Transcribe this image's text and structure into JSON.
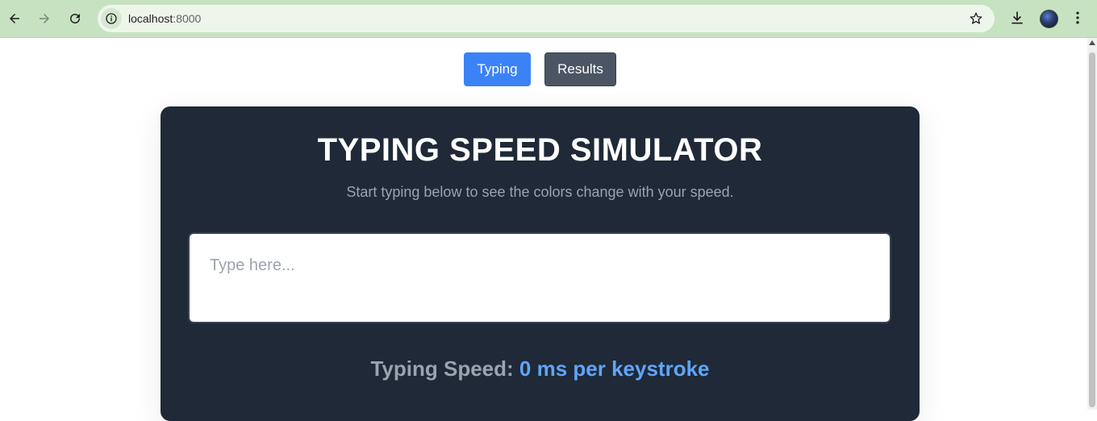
{
  "browser": {
    "url_host": "localhost",
    "url_port": ":8000"
  },
  "nav": {
    "tabs": [
      {
        "label": "Typing",
        "active": true
      },
      {
        "label": "Results",
        "active": false
      }
    ]
  },
  "main": {
    "title": "TYPING SPEED SIMULATOR",
    "subtitle": "Start typing below to see the colors change with your speed.",
    "input": {
      "value": "",
      "placeholder": "Type here..."
    },
    "speed": {
      "label": "Typing Speed:",
      "value": "0 ms per keystroke"
    }
  },
  "colors": {
    "card_bg": "#1f2937",
    "accent_blue": "#3b82f6",
    "speed_value": "#60a5fa",
    "browser_chrome": "#c7e2c1"
  },
  "icons": [
    "back-arrow-icon",
    "forward-arrow-icon",
    "reload-icon",
    "site-info-icon",
    "bookmark-star-icon",
    "download-icon",
    "profile-avatar",
    "kebab-menu-icon"
  ]
}
